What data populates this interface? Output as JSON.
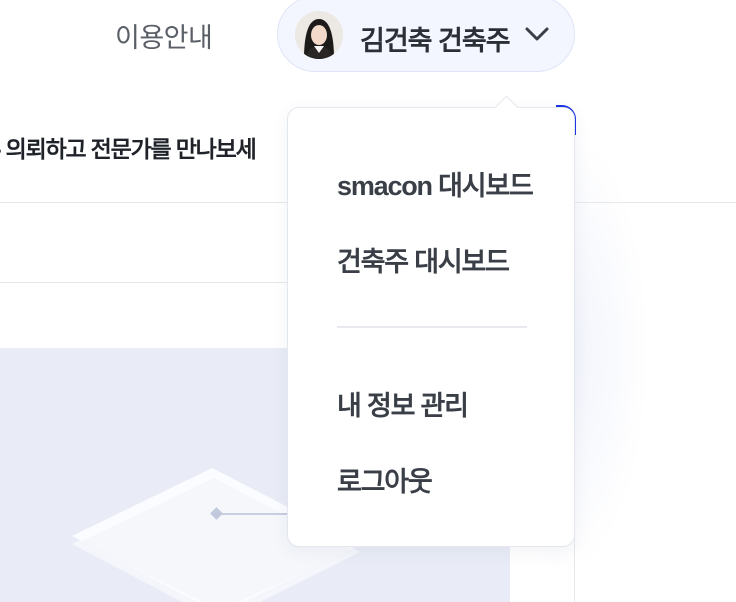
{
  "header": {
    "nav_guide_label": "이용안내",
    "user_menu": {
      "name": "김건축 건축주",
      "avatar": "avatar-photo",
      "expand_icon": "chevron-down-icon"
    }
  },
  "page": {
    "tagline": "- 의뢰하고 전문가를 만나보세"
  },
  "dropdown": {
    "items": [
      {
        "label": "smacon 대시보드"
      },
      {
        "label": "건축주 대시보드"
      },
      {
        "label": "내 정보 관리"
      },
      {
        "label": "로그아웃"
      }
    ]
  },
  "colors": {
    "accent": "#1e35e6",
    "pill_background": "#f3f6fe",
    "hero_background": "#e9ecf6",
    "menu_text": "#3a3f47"
  }
}
